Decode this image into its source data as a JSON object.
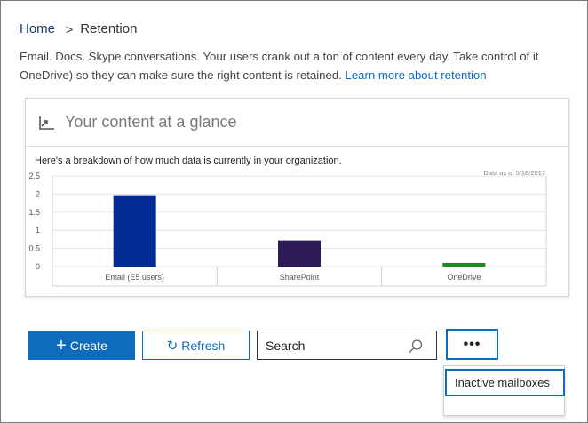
{
  "breadcrumb": {
    "home": "Home",
    "separator": ">",
    "current": "Retention"
  },
  "intro": {
    "line1": "Email. Docs. Skype conversations. Your users crank out a ton of content every day. Take control of it",
    "line2": "OneDrive) so they can make sure the right content is retained.",
    "link": "Learn more about retention"
  },
  "card": {
    "title": "Your content at a glance",
    "subtitle": "Here's a breakdown of how much data is currently in your organization.",
    "date": "Data as of 5/18/2017"
  },
  "chart_data": {
    "type": "bar",
    "categories": [
      "Email (E5 users)",
      "SharePoint",
      "OneDrive"
    ],
    "values": [
      1.97,
      0.72,
      0.1
    ],
    "colors": [
      "#002b93",
      "#2d1b58",
      "#198c1c"
    ],
    "yticks": [
      "2.5",
      "2",
      "1.5",
      "1",
      "0.5",
      "0"
    ],
    "ylim": [
      0,
      2.5
    ],
    "grid": true
  },
  "toolbar": {
    "create_label": "Create",
    "refresh_label": "Refresh",
    "search_placeholder": "Search",
    "more_label": "•••"
  },
  "menu": {
    "items": [
      "Inactive mailboxes"
    ]
  },
  "colors": {
    "accent": "#0f6cbd",
    "link": "#0f6cbd",
    "home": "#1a3d6e"
  }
}
